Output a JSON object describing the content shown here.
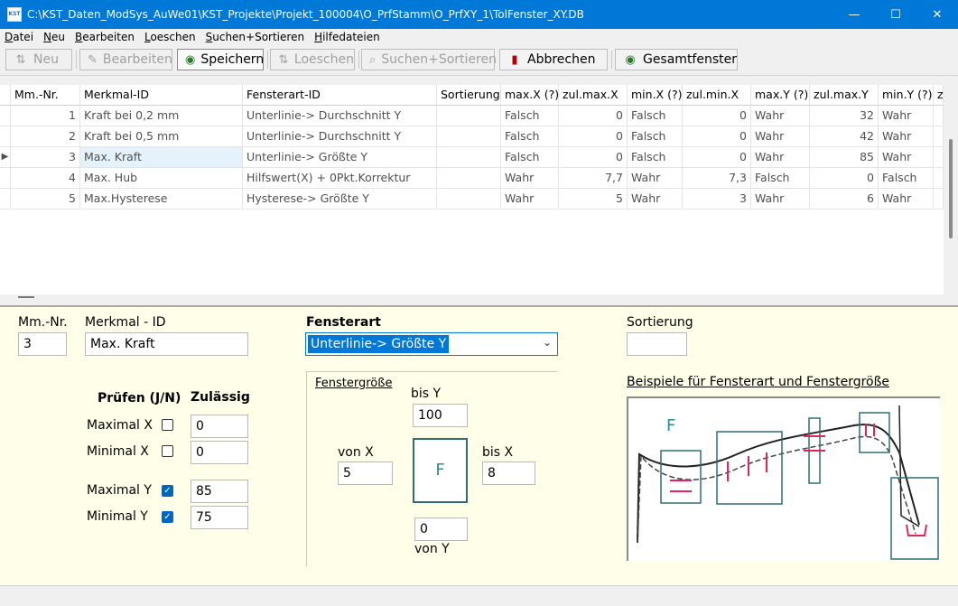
{
  "window": {
    "title": "C:\\KST_Daten_ModSys_AuWe01\\KST_Projekte\\Projekt_100004\\O_PrfStamm\\O_PrfXY_1\\TolFenster_XY.DB",
    "icon_text": "KST",
    "controls": {
      "minimize": "—",
      "maximize": "☐",
      "close": "✕"
    }
  },
  "menu": [
    {
      "label": "Datei",
      "first": "D",
      "rest": "atei"
    },
    {
      "label": "Neu",
      "first": "N",
      "rest": "eu"
    },
    {
      "label": "Bearbeiten",
      "first": "B",
      "rest": "earbeiten"
    },
    {
      "label": "Loeschen",
      "first": "L",
      "rest": "oeschen"
    },
    {
      "label": "Suchen+Sortieren",
      "first": "S",
      "rest": "uchen+Sortieren"
    },
    {
      "label": "Hilfedateien",
      "first": "H",
      "rest": "ilfedateien"
    }
  ],
  "toolbar": {
    "neu": {
      "label": "Neu",
      "icon": "new-icon",
      "glyph": "⇅",
      "enabled": false
    },
    "bearbeiten": {
      "label": "Bearbeiten",
      "icon": "edit-icon",
      "glyph": "✎",
      "enabled": false
    },
    "speichern": {
      "label": "Speichern",
      "icon": "save-icon",
      "glyph": "◉",
      "enabled": true
    },
    "loeschen": {
      "label": "Loeschen",
      "icon": "delete-icon",
      "glyph": "⇅",
      "enabled": false
    },
    "suchen": {
      "label": "Suchen+Sortieren",
      "icon": "search-icon",
      "glyph": "⌕",
      "enabled": false
    },
    "abbrechen": {
      "label": "Abbrechen",
      "icon": "cancel-icon",
      "glyph": "▮",
      "enabled": true
    },
    "gesamt": {
      "label": "Gesamtfenster",
      "icon": "window-icon",
      "glyph": "◉",
      "enabled": true
    }
  },
  "grid": {
    "columns": [
      "Mm.-Nr.",
      "Merkmal-ID",
      "Fensterart-ID",
      "Sortierung",
      "max.X (?)",
      "zul.max.X",
      "min.X (?)",
      "zul.min.X",
      "max.Y (?)",
      "zul.max.Y",
      "min.Y (?)",
      "z"
    ],
    "rows": [
      {
        "nr": "1",
        "merkmal": "Kraft bei 0,2 mm",
        "fensterart": "Unterlinie-> Durchschnitt Y",
        "sortierung": "",
        "maxX": "Falsch",
        "zulMaxX": "0",
        "minX": "Falsch",
        "zulMinX": "0",
        "maxY": "Wahr",
        "zulMaxY": "32",
        "minY": "Wahr",
        "current": false
      },
      {
        "nr": "2",
        "merkmal": "Kraft bei 0,5 mm",
        "fensterart": "Unterlinie-> Durchschnitt Y",
        "sortierung": "",
        "maxX": "Falsch",
        "zulMaxX": "0",
        "minX": "Falsch",
        "zulMinX": "0",
        "maxY": "Wahr",
        "zulMaxY": "42",
        "minY": "Wahr",
        "current": false
      },
      {
        "nr": "3",
        "merkmal": "Max. Kraft",
        "fensterart": "Unterlinie-> Größte Y",
        "sortierung": "",
        "maxX": "Falsch",
        "zulMaxX": "0",
        "minX": "Falsch",
        "zulMinX": "0",
        "maxY": "Wahr",
        "zulMaxY": "85",
        "minY": "Wahr",
        "current": true
      },
      {
        "nr": "4",
        "merkmal": "Max. Hub",
        "fensterart": "Hilfswert(X) + 0Pkt.Korrektur",
        "sortierung": "",
        "maxX": "Wahr",
        "zulMaxX": "7,7",
        "minX": "Wahr",
        "zulMinX": "7,3",
        "maxY": "Falsch",
        "zulMaxY": "0",
        "minY": "Falsch",
        "current": false
      },
      {
        "nr": "5",
        "merkmal": "Max.Hysterese",
        "fensterart": "Hysterese-> Größte Y",
        "sortierung": "",
        "maxX": "Wahr",
        "zulMaxX": "5",
        "minX": "Wahr",
        "zulMinX": "3",
        "maxY": "Wahr",
        "zulMaxY": "6",
        "minY": "Wahr",
        "current": false
      }
    ],
    "current_marker": "▶"
  },
  "form": {
    "mmnr_label": "Mm.-Nr.",
    "mmnr_value": "3",
    "merkmal_label": "Merkmal - ID",
    "merkmal_value": "Max. Kraft",
    "fensterart_label": "Fensterart",
    "fensterart_value": "Unterlinie-> Größte Y",
    "sortierung_label": "Sortierung",
    "sortierung_value": "",
    "pruefen_label": "Prüfen (J/N)",
    "zulaessig_label": "Zulässig",
    "checks": [
      {
        "label": "Maximal X",
        "checked": false,
        "value": "0"
      },
      {
        "label": "Minimal X",
        "checked": false,
        "value": "0"
      },
      {
        "label": "Maximal Y",
        "checked": true,
        "value": "85"
      },
      {
        "label": "Minimal Y",
        "checked": true,
        "value": "75"
      }
    ],
    "fenstergroesse_label": "Fenstergröße",
    "bis_y_label": "bis Y",
    "bis_y_value": "100",
    "von_x_label": "von X",
    "von_x_value": "5",
    "bis_x_label": "bis X",
    "bis_x_value": "8",
    "von_y_label": "von Y",
    "von_y_value": "0",
    "window_letter": "F",
    "beispiele_label": "Beispiele für Fensterart und Fenstergröße",
    "example_letter": "F"
  },
  "colors": {
    "accent": "#0078d7",
    "teal": "#2e6e73",
    "marker_red": "#e0245e",
    "form_bg": "#ffffe9"
  }
}
